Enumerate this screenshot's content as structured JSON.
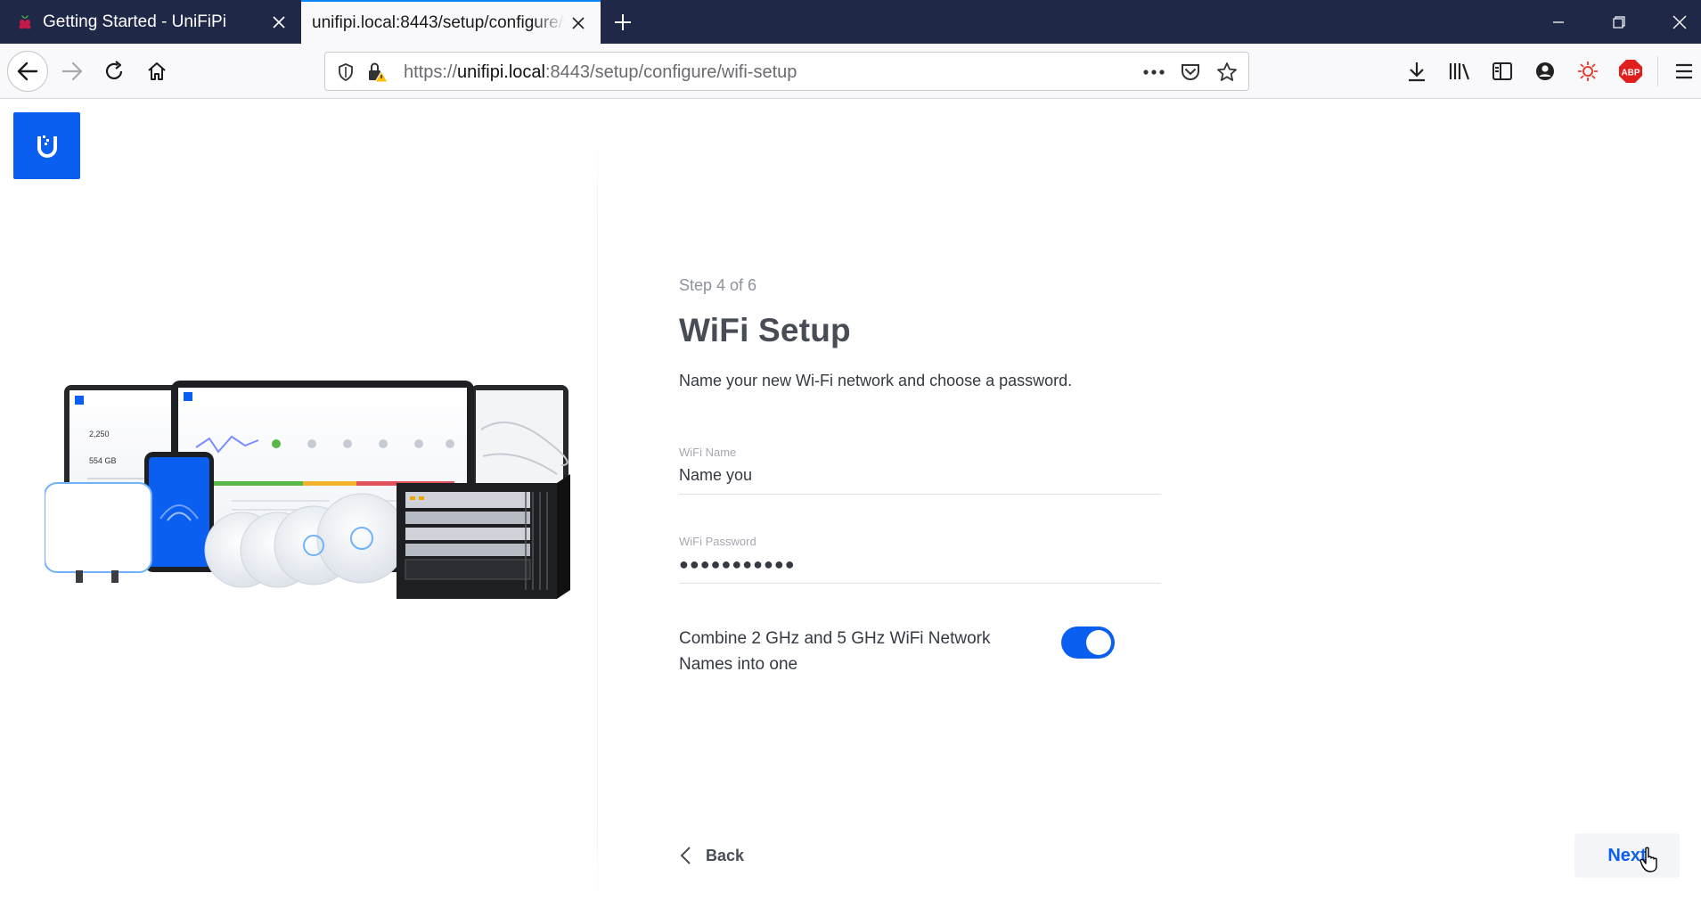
{
  "browser": {
    "tabs": [
      {
        "title": "Getting Started - UniFiPi",
        "active": false
      },
      {
        "title": "unifipi.local:8443/setup/configure/wifi-setup",
        "active": true
      }
    ],
    "url": {
      "scheme": "https://",
      "host": "unifipi.local",
      "rest": ":8443/setup/configure/wifi-setup"
    }
  },
  "page": {
    "step": "Step 4 of 6",
    "title": "WiFi Setup",
    "subtitle": "Name your new Wi-Fi network and choose a password.",
    "wifi_name": {
      "label": "WiFi Name",
      "value": "Name you"
    },
    "wifi_password": {
      "label": "WiFi Password",
      "value": "●●●●●●●●●●●"
    },
    "combine": {
      "label": "Combine 2 GHz and 5 GHz WiFi Network Names into one",
      "enabled": true
    },
    "back_label": "Back",
    "next_label": "Next"
  },
  "colors": {
    "accent": "#0b5ff0",
    "tabstrip": "#1f2947",
    "abp_red": "#e01e1e"
  }
}
